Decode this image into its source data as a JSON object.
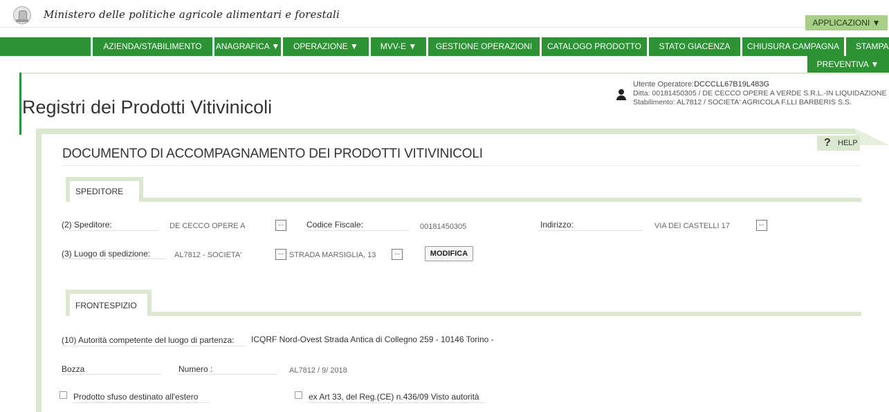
{
  "header": {
    "ministry": "Ministero delle politiche agricole alimentari e forestali",
    "applicazioni": "APPLICAZIONI ▼"
  },
  "nav": {
    "items": [
      {
        "label": "AZIENDA/STABILIMENTO"
      },
      {
        "label": "ANAGRAFICA ▼"
      },
      {
        "label": "OPERAZIONE ▼"
      },
      {
        "label": "MVV-E ▼"
      },
      {
        "label": "GESTIONE OPERAZIONI"
      },
      {
        "label": "CATALOGO PRODOTTO"
      },
      {
        "label": "STATO GIACENZA"
      },
      {
        "label": "CHIUSURA CAMPAGNA"
      },
      {
        "label": "STAMPA"
      }
    ],
    "preventiva": "PREVENTIVA ▼"
  },
  "page": {
    "title": "Registri dei Prodotti Vitivinicoli"
  },
  "user": {
    "operatore_label": "Utente Operatore:",
    "operatore_value": "DCCCLL67B19L483G",
    "ditta": "Ditta: 00181450305 / DE CECCO OPERE A VERDE S.R.L.-IN LIQUIDAZIONE",
    "stabilimento": "Stabilimento: AL7812 / SOCIETA' AGRICOLA F.LLI BARBERIS S.S."
  },
  "help": {
    "icon": "?",
    "label": "HELP"
  },
  "document": {
    "title": "DOCUMENTO DI ACCOMPAGNAMENTO DEI PRODOTTI VITIVINICOLI"
  },
  "speditore": {
    "tab": "SPEDITORE",
    "speditore_label": "(2) Speditore:",
    "speditore_value": "DE CECCO OPERE A",
    "cf_label": "Codice Fiscale:",
    "cf_value": "00181450305",
    "indirizzo_label": "Indirizzo:",
    "indirizzo_value": "VIA DEI CASTELLI 17",
    "luogo_label": "(3) Luogo di spedizione:",
    "luogo_value": "AL7812 - SOCIETA'",
    "luogo_address": "STRADA MARSIGLIA, 13",
    "modifica": "MODIFICA",
    "dots": "..."
  },
  "frontespizio": {
    "tab": "FRONTESPIZIO",
    "autorita_label": "(10) Autorità competente del luogo di partenza:",
    "autorita_value": "ICQRF Nord-Ovest Strada Antica di Collegno 259 - 10146 Torino  -",
    "bozza_label": "Bozza",
    "numero_label": "Numero :",
    "numero_value": "AL7812 / 9/ 2018",
    "sfuso_label": "Prodotto sfuso destinato all'estero",
    "art33_label": "ex Art 33, del Reg.(CE) n.436/09 Visto autorità"
  }
}
